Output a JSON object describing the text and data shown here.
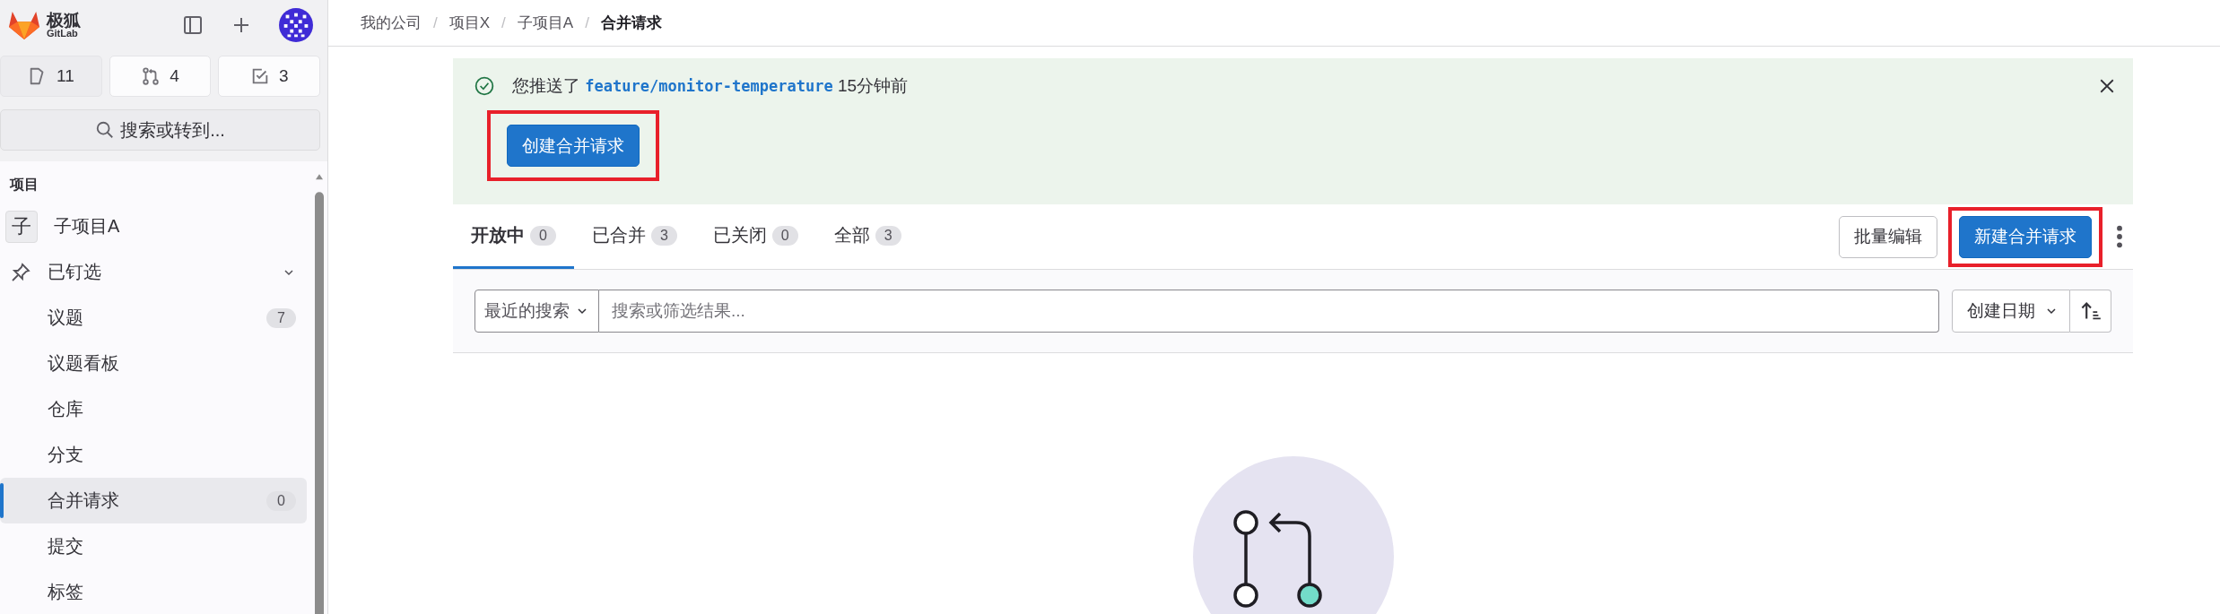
{
  "sidebar": {
    "brand": {
      "name": "极狐",
      "sub": "GitLab"
    },
    "counters": [
      {
        "kind": "issues",
        "count": "11",
        "hovered": true
      },
      {
        "kind": "merge",
        "count": "4",
        "hovered": false
      },
      {
        "kind": "todo",
        "count": "3",
        "hovered": false
      }
    ],
    "search": {
      "label": "搜索或转到..."
    },
    "section_title": "项目",
    "items": [
      {
        "kind": "project",
        "avatar": "子",
        "label": "子项目A"
      },
      {
        "kind": "pinned",
        "label": "已钉选",
        "expanded": true
      },
      {
        "kind": "link",
        "label": "议题",
        "badge": "7",
        "selected": false
      },
      {
        "kind": "link",
        "label": "议题看板",
        "selected": false
      },
      {
        "kind": "link",
        "label": "仓库",
        "selected": false
      },
      {
        "kind": "link",
        "label": "分支",
        "selected": false
      },
      {
        "kind": "link",
        "label": "合并请求",
        "badge": "0",
        "selected": true
      },
      {
        "kind": "link",
        "label": "提交",
        "selected": false
      },
      {
        "kind": "link",
        "label": "标签",
        "selected": false
      }
    ]
  },
  "breadcrumb": [
    {
      "label": "我的公司",
      "current": false
    },
    {
      "separator": "/",
      "label": "项目X",
      "current": false
    },
    {
      "separator": "/",
      "label": "子项目A",
      "current": false
    },
    {
      "separator": "/",
      "label": "合并请求",
      "current": true
    }
  ],
  "alert": {
    "text": "您推送了",
    "branch": "feature/monitor-temperature",
    "time": "15分钟前",
    "button": {
      "label": "创建合并请求",
      "highlighted": true
    }
  },
  "tabs": [
    {
      "label": "开放中",
      "count": "0",
      "selected": true
    },
    {
      "label": "已合并",
      "count": "3",
      "selected": false
    },
    {
      "label": "已关闭",
      "count": "0",
      "selected": false
    },
    {
      "label": "全部",
      "count": "3",
      "selected": false
    }
  ],
  "actions": [
    {
      "kind": "secondary",
      "label": "批量编辑",
      "highlighted": false
    },
    {
      "kind": "primary",
      "label": "新建合并请求",
      "highlighted": true
    }
  ],
  "filter": {
    "recent": "最近的搜索",
    "placeholder": "搜索或筛选结果...",
    "sort": "创建日期"
  }
}
